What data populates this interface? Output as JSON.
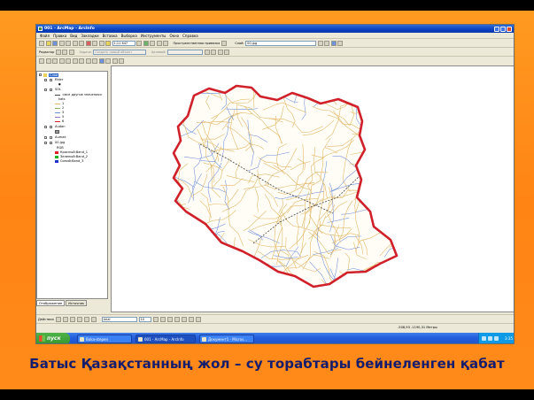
{
  "window": {
    "title": "001 - ArcMap - ArcInfo"
  },
  "menu": [
    "Файл",
    "Правка",
    "Вид",
    "Закладки",
    "Вставка",
    "Выборка",
    "Инструменты",
    "Окно",
    "Справка"
  ],
  "toolbar1": {
    "scale": "1:11 647",
    "spatial_adjustment": "Пространственная привязка",
    "layer_label": "Слой:",
    "layer_value": "00.jpg"
  },
  "toolbar2": {
    "editor": "Редактор",
    "task_label": "Задача:",
    "task_value": "Создать новый объект",
    "target_label": "Целевой:"
  },
  "toc": {
    "root": "Слои",
    "layers": [
      {
        "name": "Elder"
      },
      {
        "name": "SOL",
        "sub": "<все другие значения>",
        "field": "kats"
      },
      {
        "name": "Audan"
      },
      {
        "name": "Aumak"
      },
      {
        "name": "00.jpg",
        "field": "RGB"
      }
    ],
    "sol_values": [
      "1",
      "2",
      "3",
      "5",
      "6"
    ],
    "bands": [
      "Красный:Band_1",
      "Зеленый:Band_2",
      "Синий:Band_3"
    ],
    "tabs": [
      "Отображение",
      "Источник"
    ]
  },
  "drawbar": {
    "action": "Действия",
    "font": "Arial",
    "size": "10"
  },
  "statusbar": {
    "coords": "-508,93  -1190,31 Метры"
  },
  "taskbar": {
    "start": "пуск",
    "tasks": [
      "Boka-stepen",
      "001 - ArcMap - ArcInfo",
      "Документ1 - Micros..."
    ],
    "clock": "3:35"
  },
  "colors": {
    "boundary": "#d0202a",
    "roads": "#e2b868",
    "rivers": "#6f8fd8",
    "slide": "#ff8a18",
    "caption": "#141c6e"
  },
  "caption": "Батыс Қазақстанның жол – су торабтары бейнеленген қабат"
}
